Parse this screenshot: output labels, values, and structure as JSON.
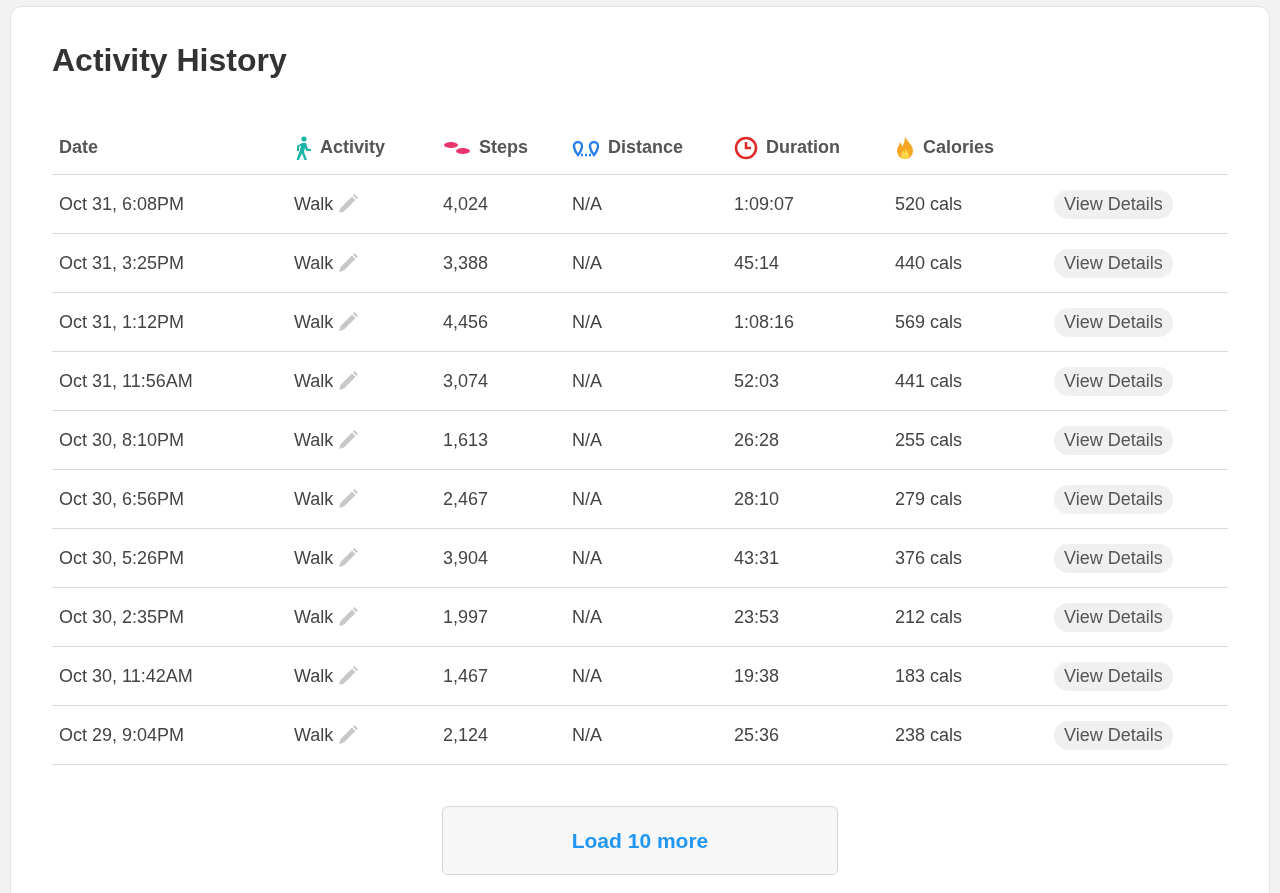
{
  "title": "Activity History",
  "columns": [
    {
      "label": "Date"
    },
    {
      "label": "Activity"
    },
    {
      "label": "Steps"
    },
    {
      "label": "Distance"
    },
    {
      "label": "Duration"
    },
    {
      "label": "Calories"
    }
  ],
  "rows": [
    {
      "date": "Oct 31, 6:08PM",
      "activity": "Walk",
      "steps": "4,024",
      "distance": "N/A",
      "duration": "1:09:07",
      "calories": "520 cals",
      "action": "View Details"
    },
    {
      "date": "Oct 31, 3:25PM",
      "activity": "Walk",
      "steps": "3,388",
      "distance": "N/A",
      "duration": "45:14",
      "calories": "440 cals",
      "action": "View Details"
    },
    {
      "date": "Oct 31, 1:12PM",
      "activity": "Walk",
      "steps": "4,456",
      "distance": "N/A",
      "duration": "1:08:16",
      "calories": "569 cals",
      "action": "View Details"
    },
    {
      "date": "Oct 31, 11:56AM",
      "activity": "Walk",
      "steps": "3,074",
      "distance": "N/A",
      "duration": "52:03",
      "calories": "441 cals",
      "action": "View Details"
    },
    {
      "date": "Oct 30, 8:10PM",
      "activity": "Walk",
      "steps": "1,613",
      "distance": "N/A",
      "duration": "26:28",
      "calories": "255 cals",
      "action": "View Details"
    },
    {
      "date": "Oct 30, 6:56PM",
      "activity": "Walk",
      "steps": "2,467",
      "distance": "N/A",
      "duration": "28:10",
      "calories": "279 cals",
      "action": "View Details"
    },
    {
      "date": "Oct 30, 5:26PM",
      "activity": "Walk",
      "steps": "3,904",
      "distance": "N/A",
      "duration": "43:31",
      "calories": "376 cals",
      "action": "View Details"
    },
    {
      "date": "Oct 30, 2:35PM",
      "activity": "Walk",
      "steps": "1,997",
      "distance": "N/A",
      "duration": "23:53",
      "calories": "212 cals",
      "action": "View Details"
    },
    {
      "date": "Oct 30, 11:42AM",
      "activity": "Walk",
      "steps": "1,467",
      "distance": "N/A",
      "duration": "19:38",
      "calories": "183 cals",
      "action": "View Details"
    },
    {
      "date": "Oct 29, 9:04PM",
      "activity": "Walk",
      "steps": "2,124",
      "distance": "N/A",
      "duration": "25:36",
      "calories": "238 cals",
      "action": "View Details"
    }
  ],
  "load_more": "Load 10 more"
}
